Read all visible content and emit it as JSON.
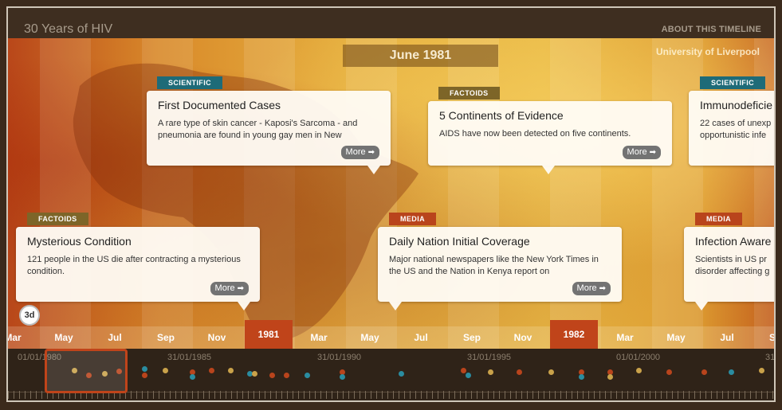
{
  "header": {
    "title": "30 Years of HIV",
    "about_label": "ABOUT THIS TIMELINE"
  },
  "stage": {
    "current_date": "June 1981",
    "attribution": "University of Liverpool",
    "zoom_badge": "3d"
  },
  "events": [
    {
      "category": "SCIENTIFIC",
      "title": "First Documented Cases",
      "body": "A rare type of skin cancer - Kaposi's Sarcoma - and pneumonia are found in young gay men in New",
      "more_label": "More"
    },
    {
      "category": "FACTOIDS",
      "title": "5 Continents of Evidence",
      "body": "AIDS have now been detected on five continents.",
      "more_label": "More"
    },
    {
      "category": "SCIENTIFIC",
      "title": "Immunodeficie",
      "body": "22 cases of unexp opportunistic infe",
      "more_label": ""
    },
    {
      "category": "FACTOIDS",
      "title": "Mysterious Condition",
      "body": "121 people in the US die after contracting a mysterious condition.",
      "more_label": "More"
    },
    {
      "category": "MEDIA",
      "title": "Daily Nation Initial Coverage",
      "body": "Major national newspapers like the New York Times in the US and the Nation in Kenya report on",
      "more_label": "More"
    },
    {
      "category": "MEDIA",
      "title": "Infection Aware",
      "body": "Scientists in US pr disorder affecting g",
      "more_label": ""
    }
  ],
  "month_axis": [
    "Mar",
    "May",
    "Jul",
    "Sep",
    "Nov",
    "1981",
    "Mar",
    "May",
    "Jul",
    "Sep",
    "Nov",
    "1982",
    "Mar",
    "May",
    "Jul",
    "Sep"
  ],
  "overview": {
    "dates": [
      "01/01/1980",
      "31/01/1985",
      "31/01/1990",
      "31/01/1995",
      "01/01/2000",
      "31"
    ]
  },
  "colors": {
    "scientific": "#1e6b78",
    "factoids": "#7d6528",
    "media": "#b9441c",
    "year_marker": "#c0441a"
  }
}
